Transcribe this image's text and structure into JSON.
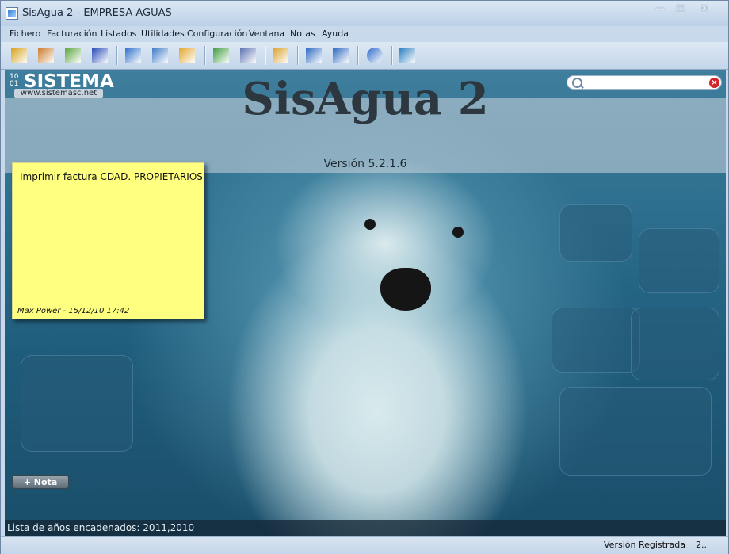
{
  "window": {
    "title": "SisAgua 2 - EMPRESA AGUAS",
    "minimize": "—",
    "maximize": "□",
    "close": "✕"
  },
  "menu": [
    "Fichero",
    "Facturación",
    "Listados",
    "Utilidades",
    "Configuración",
    "Ventana",
    "Notas",
    "Ayuda"
  ],
  "toolbar": {
    "buttons": [
      {
        "icon": "key-icon",
        "color": "#d4a017"
      },
      {
        "icon": "house-icon",
        "color": "#c97a2b"
      },
      {
        "icon": "gear-settings-icon",
        "color": "#5aa33a"
      },
      {
        "icon": "flag-icon",
        "color": "#2448b8"
      },
      {
        "icon": "book-icon",
        "color": "#2a6fc9"
      },
      {
        "icon": "calculator-icon",
        "color": "#3b79c8"
      },
      {
        "icon": "invoices-icon",
        "color": "#e0a52a"
      },
      {
        "icon": "checklist-icon",
        "color": "#3b9b3e"
      },
      {
        "icon": "network-icon",
        "color": "#5a6fb0"
      },
      {
        "icon": "tools-icon",
        "color": "#d9a02a"
      },
      {
        "icon": "tile-vertical-icon",
        "color": "#2a66c0"
      },
      {
        "icon": "tile-horizontal-icon",
        "color": "#2a66c0"
      },
      {
        "icon": "help-icon",
        "color": "#2b68c9"
      },
      {
        "icon": "exit-door-icon",
        "color": "#2a7ec0"
      }
    ]
  },
  "logo": {
    "bits": "10 01",
    "brand": "SISTEMA",
    "url": "www.sistemasc.net"
  },
  "search": {
    "value": "",
    "placeholder": ""
  },
  "banner": {
    "title": "SisAgua 2",
    "version": "Versión 5.2.1.6"
  },
  "note": {
    "text": "Imprimir factura CDAD. PROPIETARIOS",
    "footer": "Max Power - 15/12/10 17:42"
  },
  "add_note_label": "+ Nota",
  "years_label": "Lista de años encadenados: 2011,2010",
  "status": {
    "registered": "Versión Registrada",
    "extra": "2.."
  }
}
